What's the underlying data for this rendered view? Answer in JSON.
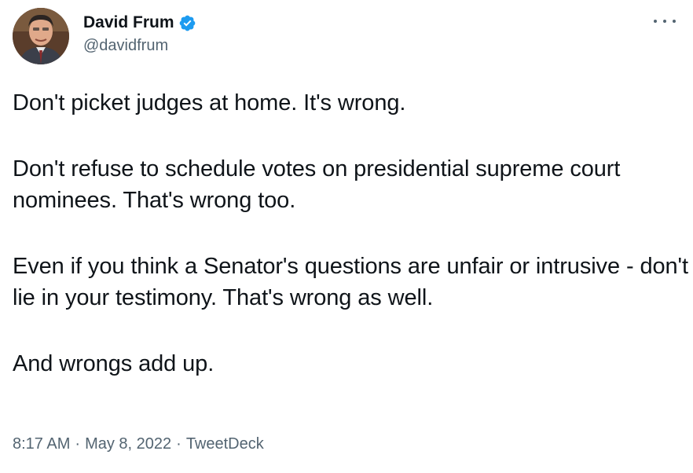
{
  "author": {
    "display_name": "David Frum",
    "handle": "@davidfrum",
    "verified": true,
    "verified_icon": "verified-badge-icon",
    "verified_color": "#1d9bf0"
  },
  "menu": {
    "icon": "more-options-icon"
  },
  "tweet": {
    "paragraphs": [
      "Don't picket judges at home. It's wrong.",
      "Don't refuse to schedule votes on presidential supreme court nominees. That's wrong too.",
      "Even if you think a Senator's questions are unfair or intrusive - don't lie in your testimony. That's wrong as well.",
      "And wrongs add up."
    ]
  },
  "meta": {
    "time": "8:17 AM",
    "separator": "·",
    "date": "May 8, 2022",
    "source": "TweetDeck"
  },
  "colors": {
    "text": "#0f1419",
    "secondary": "#536471",
    "background": "#ffffff"
  }
}
